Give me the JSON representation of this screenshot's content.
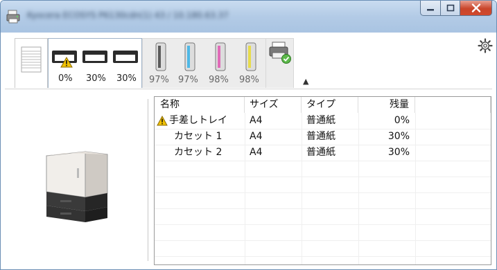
{
  "window": {
    "title": "Kyocera ECOSYS P6130cdn(1) 43 / 10.180.63.37",
    "controls": {
      "minimize": "minimize",
      "maximize": "maximize",
      "close": "close"
    }
  },
  "tray_tabs": {
    "trays": [
      {
        "name": "manual-tray",
        "level": "0%",
        "warning": true
      },
      {
        "name": "cassette-1",
        "level": "30%",
        "warning": false
      },
      {
        "name": "cassette-2",
        "level": "30%",
        "warning": false
      }
    ]
  },
  "toner_tabs": {
    "toners": [
      {
        "color": "black",
        "hex": "#5b5b5b",
        "level": "97%"
      },
      {
        "color": "cyan",
        "hex": "#4fb8e6",
        "level": "97%"
      },
      {
        "color": "magenta",
        "hex": "#e06bb8",
        "level": "98%"
      },
      {
        "color": "yellow",
        "hex": "#e8dc4a",
        "level": "98%"
      }
    ]
  },
  "table": {
    "headers": {
      "name": "名称",
      "size": "サイズ",
      "type": "タイプ",
      "remaining": "残量"
    },
    "rows": [
      {
        "name": "手差しトレイ",
        "size": "A4",
        "type": "普通紙",
        "remaining": "0%",
        "warning": true
      },
      {
        "name": "カセット 1",
        "size": "A4",
        "type": "普通紙",
        "remaining": "30%",
        "warning": false
      },
      {
        "name": "カセット 2",
        "size": "A4",
        "type": "普通紙",
        "remaining": "30%",
        "warning": false
      }
    ]
  },
  "icons": {
    "warning": "warning-icon",
    "gear": "gear-icon",
    "expand": "chevron-up-icon",
    "device_status": "printer-status-icon"
  }
}
